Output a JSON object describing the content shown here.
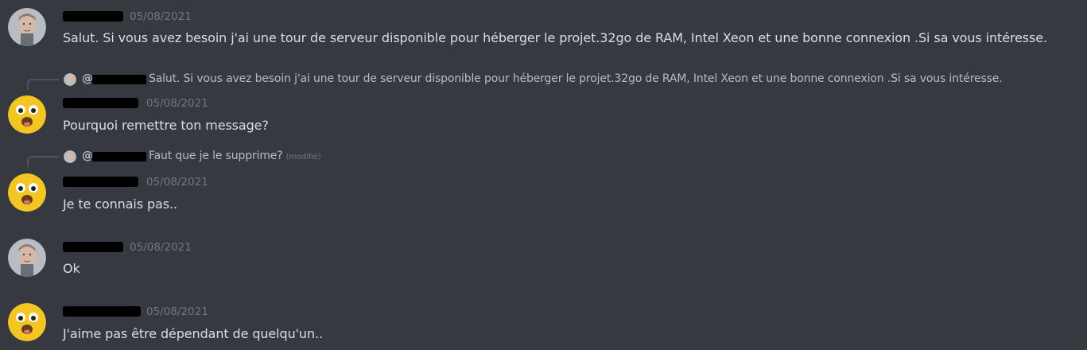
{
  "messages": [
    {
      "avatar": "man-avatar",
      "timestamp": "05/08/2021",
      "content": "Salut. Si vous avez besoin j'ai une tour de serveur disponible pour héberger le projet.32go de RAM, Intel Xeon et une bonne connexion .Si sa vous intéresse."
    },
    {
      "avatar": "yellow-blob-avatar",
      "reply": {
        "at": "@",
        "text": "Salut. Si vous avez besoin j'ai une tour de serveur disponible pour héberger le projet.32go de RAM, Intel Xeon et une bonne connexion .Si sa vous intéresse."
      },
      "timestamp": "05/08/2021",
      "content": "Pourquoi remettre ton message?"
    },
    {
      "avatar": "yellow-blob-avatar",
      "reply": {
        "at": "@",
        "text": "Faut que je le supprime?",
        "edited": "(modifié)"
      },
      "timestamp": "05/08/2021",
      "content": "Je te connais pas.."
    },
    {
      "avatar": "man-avatar",
      "timestamp": "05/08/2021",
      "content": "Ok"
    },
    {
      "avatar": "yellow-blob-avatar",
      "timestamp": "05/08/2021",
      "content": "J'aime pas être dépendant de quelqu'un.."
    }
  ]
}
